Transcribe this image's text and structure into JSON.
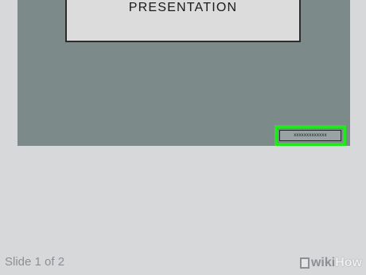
{
  "slide": {
    "title": "PRESENTATION",
    "footer_text": "xxxxxxxxxxxxx"
  },
  "status": {
    "slide_counter": "Slide 1 of 2"
  },
  "watermark": {
    "part1": "wiki",
    "part2": "How"
  },
  "colors": {
    "app_background": "#d7d8da",
    "slide_background": "#7c8b8a",
    "title_box": "#dcdcdc",
    "highlight": "#22e61e"
  }
}
